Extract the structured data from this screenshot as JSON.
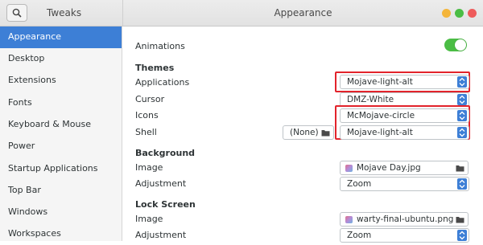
{
  "header": {
    "sidebar_title": "Tweaks",
    "main_title": "Appearance"
  },
  "sidebar": {
    "items": [
      {
        "label": "Appearance",
        "active": true
      },
      {
        "label": "Desktop"
      },
      {
        "label": "Extensions"
      },
      {
        "label": "Fonts"
      },
      {
        "label": "Keyboard & Mouse"
      },
      {
        "label": "Power"
      },
      {
        "label": "Startup Applications"
      },
      {
        "label": "Top Bar"
      },
      {
        "label": "Windows"
      },
      {
        "label": "Workspaces"
      }
    ]
  },
  "main": {
    "animations": {
      "label": "Animations",
      "enabled": true
    },
    "themes": {
      "heading": "Themes",
      "applications": {
        "label": "Applications",
        "value": "Mojave-light-alt"
      },
      "cursor": {
        "label": "Cursor",
        "value": "DMZ-White"
      },
      "icons": {
        "label": "Icons",
        "value": "McMojave-circle"
      },
      "shell": {
        "label": "Shell",
        "none_value": "(None)",
        "value": "Mojave-light-alt"
      }
    },
    "background": {
      "heading": "Background",
      "image": {
        "label": "Image",
        "value": "Mojave Day.jpg"
      },
      "adjustment": {
        "label": "Adjustment",
        "value": "Zoom"
      }
    },
    "lock_screen": {
      "heading": "Lock Screen",
      "image": {
        "label": "Image",
        "value": "warty-final-ubuntu.png"
      },
      "adjustment": {
        "label": "Adjustment",
        "value": "Zoom"
      }
    }
  },
  "colors": {
    "accent": "#3d7fd6",
    "toggle_on": "#4bbd45",
    "highlight_box": "#e2232b"
  }
}
